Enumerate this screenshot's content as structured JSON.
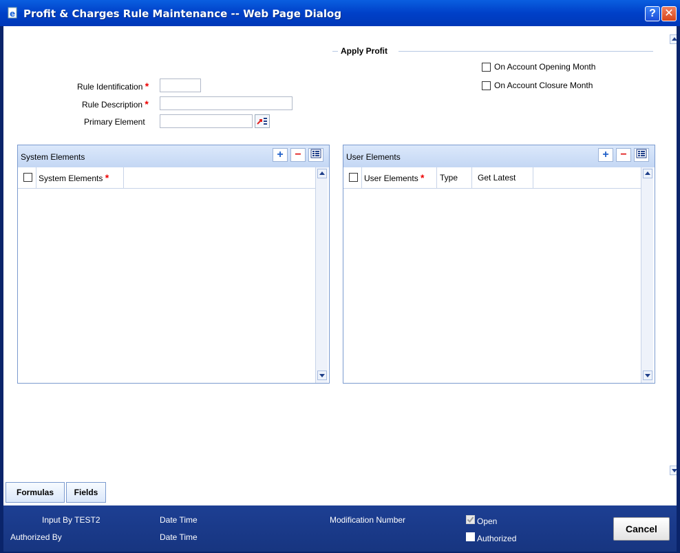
{
  "window": {
    "title": "Profit & Charges Rule Maintenance -- Web Page Dialog",
    "help": "?",
    "close": "✕"
  },
  "form": {
    "rule_identification_label": "Rule Identification",
    "rule_description_label": "Rule Description",
    "primary_element_label": "Primary Element",
    "required_mark": "*",
    "rule_identification_value": "",
    "rule_description_value": "",
    "primary_element_value": ""
  },
  "apply_profit": {
    "title": "Apply Profit",
    "on_opening_label": "On Account Opening Month",
    "on_closure_label": "On Account Closure Month",
    "on_opening_checked": false,
    "on_closure_checked": false
  },
  "system_elements": {
    "title": "System Elements",
    "add": "+",
    "remove": "−",
    "columns": [
      "System Elements"
    ],
    "rows": []
  },
  "user_elements": {
    "title": "User Elements",
    "add": "+",
    "remove": "−",
    "columns": [
      "User Elements",
      "Type",
      "Get Latest"
    ],
    "rows": []
  },
  "tabs": [
    "Formulas",
    "Fields"
  ],
  "footer": {
    "input_by": "Input By TEST2",
    "authorized_by": "Authorized By",
    "date_time_1": "Date Time",
    "date_time_2": "Date Time",
    "modification_number": "Modification Number",
    "open_label": "Open",
    "authorized_label": "Authorized",
    "open_checked": true,
    "authorized_checked": false,
    "cancel_label": "Cancel"
  },
  "colors": {
    "title_bar": "#0040c8",
    "footer": "#1d3f93",
    "required": "#e00000",
    "panel_border": "#7a9acf"
  }
}
